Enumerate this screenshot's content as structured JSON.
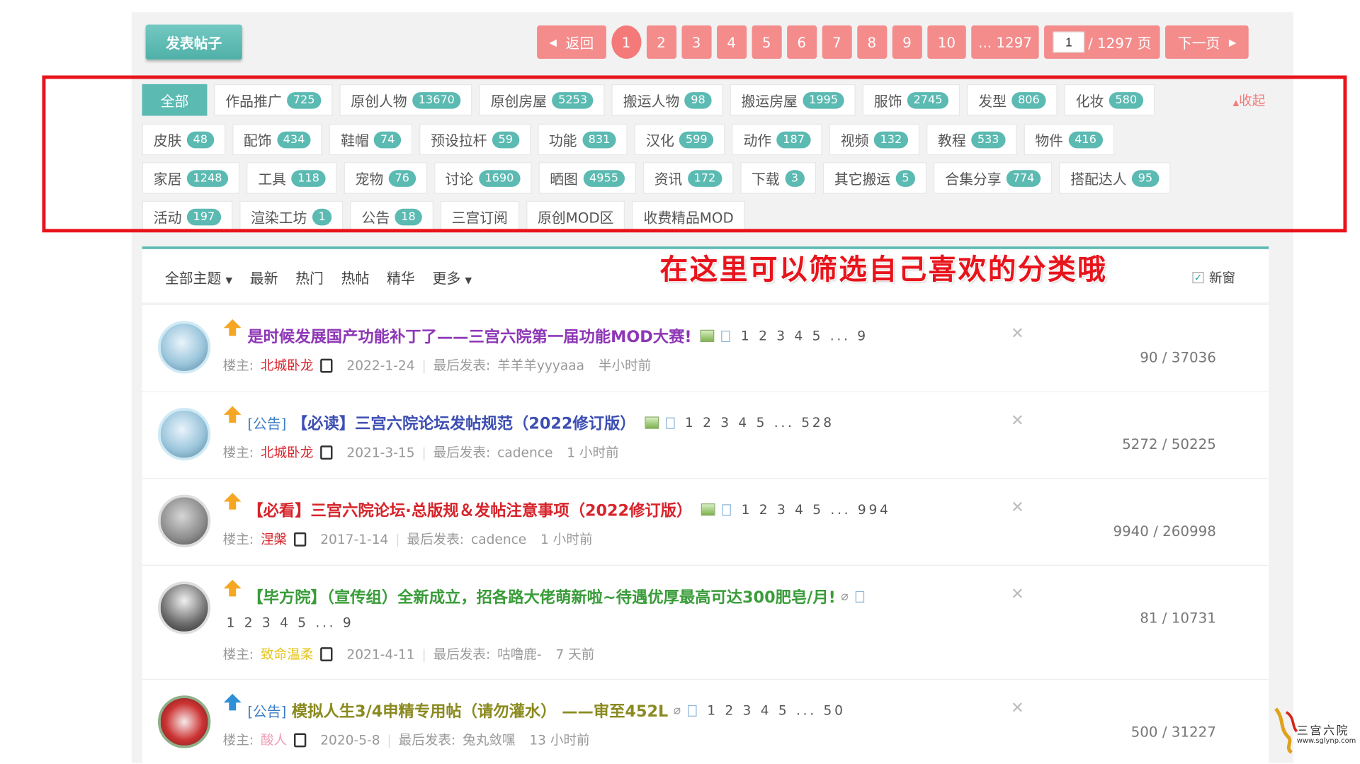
{
  "toolbar": {
    "post_button": "发表帖子",
    "back": "返回",
    "pages": [
      "1",
      "2",
      "3",
      "4",
      "5",
      "6",
      "7",
      "8",
      "9",
      "10"
    ],
    "last_page": "... 1297",
    "page_input": "1",
    "page_total": "/ 1297 页",
    "next": "下一页"
  },
  "categories": {
    "collapse": "收起",
    "row1": [
      {
        "label": "全部",
        "count": ""
      },
      {
        "label": "作品推广",
        "count": "725"
      },
      {
        "label": "原创人物",
        "count": "13670"
      },
      {
        "label": "原创房屋",
        "count": "5253"
      },
      {
        "label": "搬运人物",
        "count": "98"
      },
      {
        "label": "搬运房屋",
        "count": "1995"
      },
      {
        "label": "服饰",
        "count": "2745"
      },
      {
        "label": "发型",
        "count": "806"
      },
      {
        "label": "化妆",
        "count": "580"
      }
    ],
    "row2": [
      {
        "label": "皮肤",
        "count": "48"
      },
      {
        "label": "配饰",
        "count": "434"
      },
      {
        "label": "鞋帽",
        "count": "74"
      },
      {
        "label": "预设拉杆",
        "count": "59"
      },
      {
        "label": "功能",
        "count": "831"
      },
      {
        "label": "汉化",
        "count": "599"
      },
      {
        "label": "动作",
        "count": "187"
      },
      {
        "label": "视频",
        "count": "132"
      },
      {
        "label": "教程",
        "count": "533"
      },
      {
        "label": "物件",
        "count": "416"
      }
    ],
    "row3": [
      {
        "label": "家居",
        "count": "1248"
      },
      {
        "label": "工具",
        "count": "118"
      },
      {
        "label": "宠物",
        "count": "76"
      },
      {
        "label": "讨论",
        "count": "1690"
      },
      {
        "label": "晒图",
        "count": "4955"
      },
      {
        "label": "资讯",
        "count": "172"
      },
      {
        "label": "下载",
        "count": "3"
      },
      {
        "label": "其它搬运",
        "count": "5"
      },
      {
        "label": "合集分享",
        "count": "774"
      },
      {
        "label": "搭配达人",
        "count": "95"
      }
    ],
    "row4": [
      {
        "label": "活动",
        "count": "197"
      },
      {
        "label": "渲染工坊",
        "count": "1"
      },
      {
        "label": "公告",
        "count": "18"
      },
      {
        "label": "三宫订阅",
        "count": ""
      },
      {
        "label": "原创MOD区",
        "count": ""
      },
      {
        "label": "收费精品MOD",
        "count": ""
      }
    ]
  },
  "filters": {
    "all_topics": "全部主题",
    "latest": "最新",
    "hot": "热门",
    "hot_posts": "热帖",
    "digest": "精华",
    "more": "更多",
    "annotation": "在这里可以筛选自己喜欢的分类哦",
    "new_window": "新窗"
  },
  "threads": [
    {
      "prefix": "",
      "title": "是时候发展国产功能补丁了——三宫六院第一届功能MOD大赛!",
      "pages": "1 2 3 4 5 ... 9",
      "owner_label": "楼主:",
      "author": "北城卧龙",
      "date": "2022-1-24",
      "last_label": "最后发表:",
      "last_user": "羊羊羊yyyaaa",
      "last_time": "半小时前",
      "count": "90 / 37036"
    },
    {
      "prefix": "[公告]",
      "title": "【必读】三宫六院论坛发帖规范（2022修订版）",
      "pages": "1 2 3 4 5 ... 528",
      "owner_label": "楼主:",
      "author": "北城卧龙",
      "date": "2021-3-15",
      "last_label": "最后发表:",
      "last_user": "cadence",
      "last_time": "1 小时前",
      "count": "5272 / 50225"
    },
    {
      "prefix": "",
      "title": "【必看】三宫六院论坛·总版规＆发帖注意事项（2022修订版）",
      "pages": "1 2 3 4 5 ... 994",
      "owner_label": "楼主:",
      "author": "涅槃",
      "date": "2017-1-14",
      "last_label": "最后发表:",
      "last_user": "cadence",
      "last_time": "1 小时前",
      "count": "9940 / 260998"
    },
    {
      "prefix": "",
      "title": "【毕方院】（宣传组）全新成立，招各路大佬萌新啦~待遇优厚最高可达300肥皂/月!",
      "pages": "1 2 3 4 5 ... 9",
      "owner_label": "楼主:",
      "author": "致命温柔",
      "date": "2021-4-11",
      "last_label": "最后发表:",
      "last_user": "咕噜鹿-",
      "last_time": "7 天前",
      "count": "81 / 10731"
    },
    {
      "prefix": "[公告]",
      "title": "模拟人生3/4申精专用帖（请勿灌水） ——审至452L",
      "pages": "1 2 3 4 5 ... 50",
      "owner_label": "楼主:",
      "author": "酸人",
      "date": "2020-5-8",
      "last_label": "最后发表:",
      "last_user": "兔丸敛嘿",
      "last_time": "13 小时前",
      "count": "500 / 31227"
    }
  ],
  "watermark": {
    "name": "三宫六院",
    "url": "www.sglynp.com"
  },
  "colors": {
    "accent": "#5bbab2",
    "pager": "#f48c8c",
    "annotation_red": "#e8141c"
  }
}
